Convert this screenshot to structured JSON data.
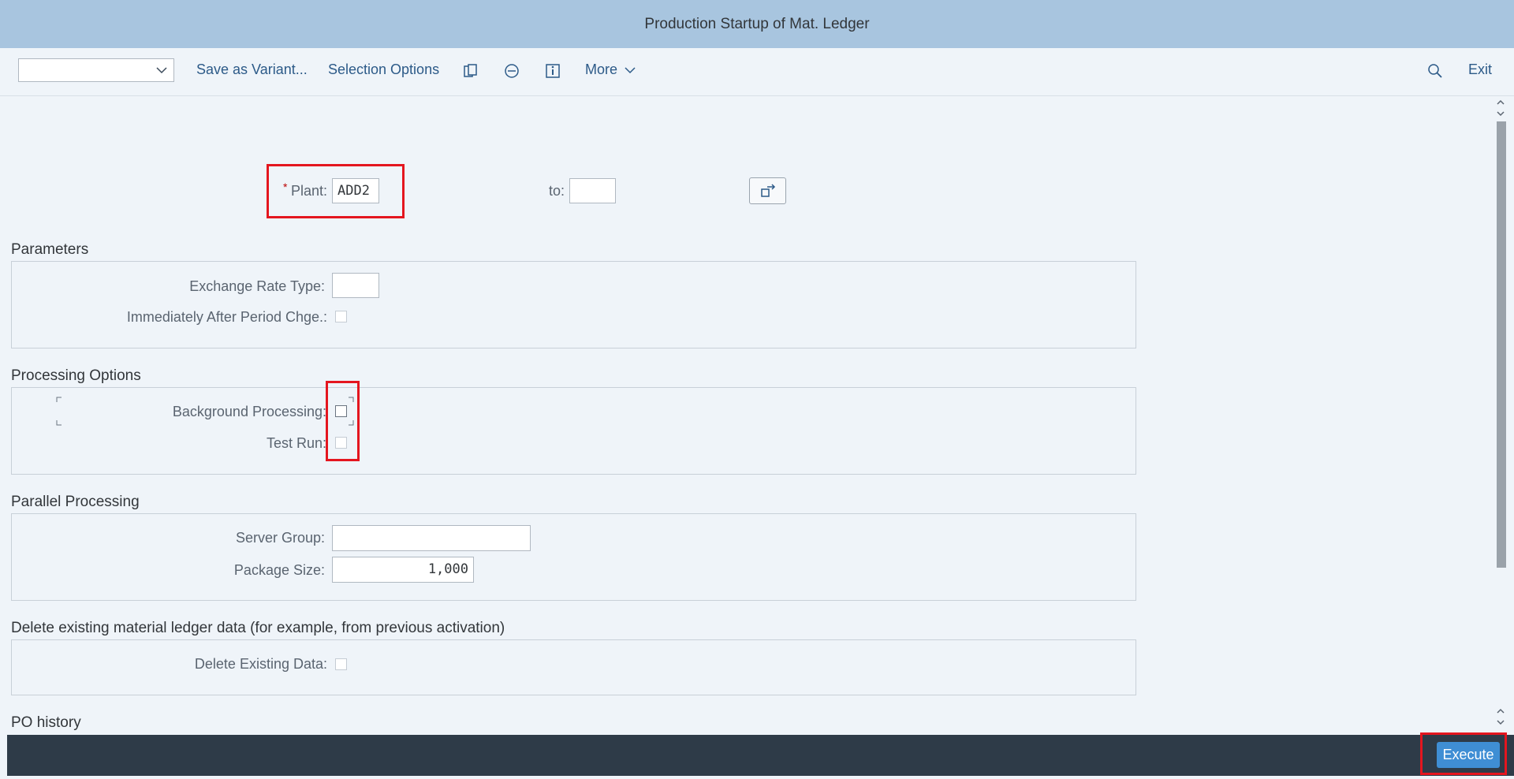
{
  "window": {
    "title": "Production Startup of Mat. Ledger"
  },
  "toolbar": {
    "variant_value": "",
    "save_variant": "Save as Variant...",
    "selection_options": "Selection Options",
    "more": "More",
    "exit": "Exit"
  },
  "selection": {
    "plant_required_mark": "*",
    "plant_label": "Plant:",
    "plant_value": "ADD2",
    "to_label": "to:",
    "to_value": ""
  },
  "parameters": {
    "title": "Parameters",
    "exchange_rate_label": "Exchange Rate Type:",
    "exchange_rate_value": "",
    "after_period_label": "Immediately After Period Chge.:"
  },
  "processing": {
    "title": "Processing Options",
    "background_label": "Background Processing:",
    "test_run_label": "Test Run:"
  },
  "parallel": {
    "title": "Parallel Processing",
    "server_group_label": "Server Group:",
    "server_group_value": "",
    "package_size_label": "Package Size:",
    "package_size_value": "1,000"
  },
  "delete": {
    "title": "Delete existing material ledger data (for example, from previous activation)",
    "delete_label": "Delete Existing Data:"
  },
  "po_history": {
    "title": "PO history"
  },
  "footer": {
    "execute": "Execute"
  },
  "colors": {
    "header": "#a8c5df",
    "accent": "#3f8ed4",
    "highlight": "#e4161f",
    "footer": "#2e3b48"
  }
}
